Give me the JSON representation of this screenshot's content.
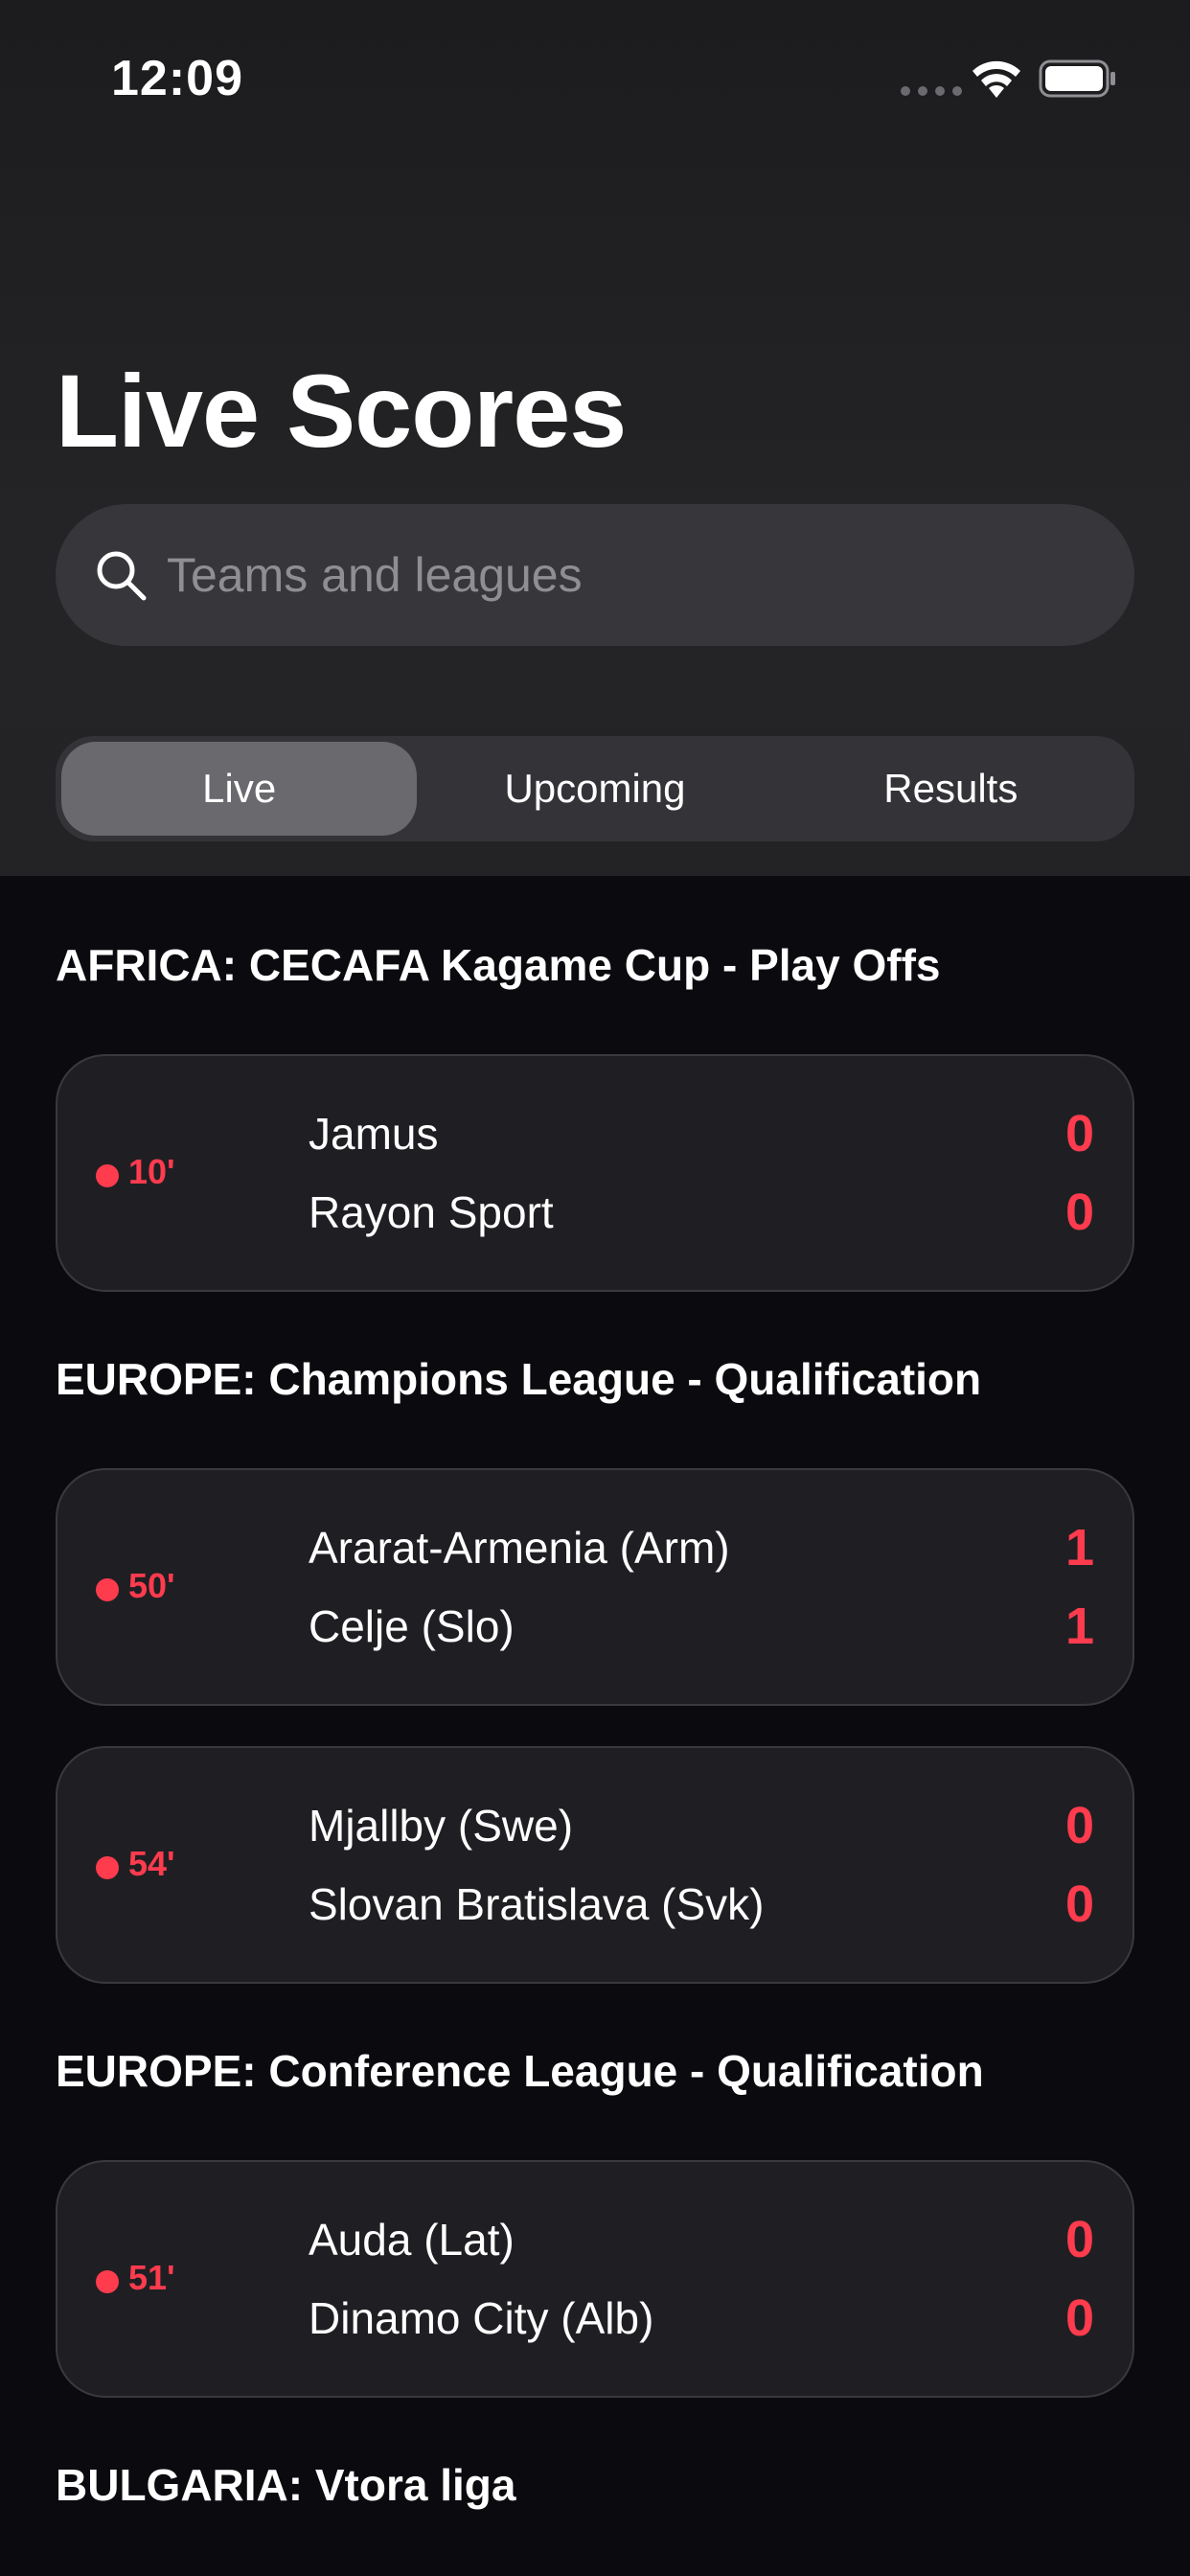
{
  "status_bar": {
    "time": "12:09"
  },
  "header": {
    "title": "Live Scores",
    "search_placeholder": "Teams and leagues"
  },
  "tabs": [
    {
      "label": "Live",
      "active": true
    },
    {
      "label": "Upcoming",
      "active": false
    },
    {
      "label": "Results",
      "active": false
    }
  ],
  "colors": {
    "accent_live": "#ff3b4e",
    "card": "#1f1f23",
    "background": "#0b0b0f"
  },
  "leagues": [
    {
      "name": "AFRICA: CECAFA Kagame Cup - Play Offs",
      "matches": [
        {
          "minute": "10'",
          "home": "Jamus",
          "away": "Rayon Sport",
          "home_score": "0",
          "away_score": "0"
        }
      ]
    },
    {
      "name": "EUROPE: Champions League - Qualification",
      "matches": [
        {
          "minute": "50'",
          "home": "Ararat-Armenia (Arm)",
          "away": "Celje (Slo)",
          "home_score": "1",
          "away_score": "1"
        },
        {
          "minute": "54'",
          "home": "Mjallby (Swe)",
          "away": "Slovan Bratislava (Svk)",
          "home_score": "0",
          "away_score": "0"
        }
      ]
    },
    {
      "name": "EUROPE: Conference League - Qualification",
      "matches": [
        {
          "minute": "51'",
          "home": "Auda (Lat)",
          "away": "Dinamo City (Alb)",
          "home_score": "0",
          "away_score": "0"
        }
      ]
    },
    {
      "name": "BULGARIA: Vtora liga",
      "matches": []
    }
  ]
}
